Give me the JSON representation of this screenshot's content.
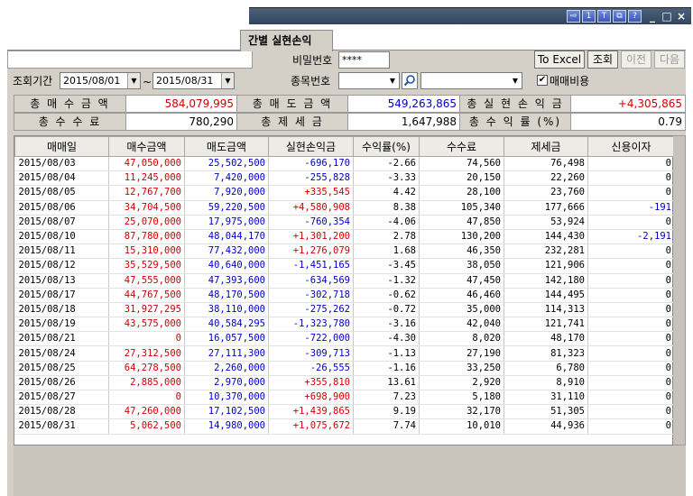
{
  "tab": {
    "title": "간별 실현손익"
  },
  "query": {
    "period_label": "조회기간",
    "start_date": "2015/08/01",
    "tilde": "~",
    "end_date": "2015/08/31",
    "password_label": "비밀번호",
    "password_value": "****",
    "stock_label": "종목번호",
    "excel_button": "To Excel",
    "search_button": "조회",
    "prev_button": "이전",
    "next_button": "다음",
    "fee_checkbox_label": "매매비용",
    "fee_checkbox_checked": true
  },
  "summary": {
    "total_buy_label": "총 매 수 금 액",
    "total_buy_value": "584,079,995",
    "total_sell_label": "총 매 도 금 액",
    "total_sell_value": "549,263,865",
    "total_realized_label": "총 실 현 손 익 금",
    "total_realized_value": "+4,305,865",
    "total_fee_label": "총 수 수 료",
    "total_fee_value": "780,290",
    "total_tax_label": "총 제 세 금",
    "total_tax_value": "1,647,988",
    "total_return_label": "총 수 익 률 (%)",
    "total_return_value": "0.79"
  },
  "table": {
    "columns": [
      "매매일",
      "매수금액",
      "매도금액",
      "실현손익금",
      "수익률(%)",
      "수수료",
      "제세금",
      "신용이자"
    ],
    "rows": [
      [
        "2015/08/03",
        "47,050,000",
        "25,502,500",
        "-696,170",
        "-2.66",
        "74,560",
        "76,498",
        "0"
      ],
      [
        "2015/08/04",
        "11,245,000",
        "7,420,000",
        "-255,828",
        "-3.33",
        "20,150",
        "22,260",
        "0"
      ],
      [
        "2015/08/05",
        "12,767,700",
        "7,920,000",
        "+335,545",
        "4.42",
        "28,100",
        "23,760",
        "0"
      ],
      [
        "2015/08/06",
        "34,704,500",
        "59,220,500",
        "+4,580,908",
        "8.38",
        "105,340",
        "177,666",
        "-191"
      ],
      [
        "2015/08/07",
        "25,070,000",
        "17,975,000",
        "-760,354",
        "-4.06",
        "47,850",
        "53,924",
        "0"
      ],
      [
        "2015/08/10",
        "87,780,000",
        "48,044,170",
        "+1,301,200",
        "2.78",
        "130,200",
        "144,430",
        "-2,191"
      ],
      [
        "2015/08/11",
        "15,310,000",
        "77,432,000",
        "+1,276,079",
        "1.68",
        "46,350",
        "232,281",
        "0"
      ],
      [
        "2015/08/12",
        "35,529,500",
        "40,640,000",
        "-1,451,165",
        "-3.45",
        "38,050",
        "121,906",
        "0"
      ],
      [
        "2015/08/13",
        "47,555,000",
        "47,393,600",
        "-634,569",
        "-1.32",
        "47,450",
        "142,180",
        "0"
      ],
      [
        "2015/08/17",
        "44,767,500",
        "48,170,500",
        "-302,718",
        "-0.62",
        "46,460",
        "144,495",
        "0"
      ],
      [
        "2015/08/18",
        "31,927,295",
        "38,110,000",
        "-275,262",
        "-0.72",
        "35,000",
        "114,313",
        "0"
      ],
      [
        "2015/08/19",
        "43,575,000",
        "40,584,295",
        "-1,323,780",
        "-3.16",
        "42,040",
        "121,741",
        "0"
      ],
      [
        "2015/08/21",
        "0",
        "16,057,500",
        "-722,000",
        "-4.30",
        "8,020",
        "48,170",
        "0"
      ],
      [
        "2015/08/24",
        "27,312,500",
        "27,111,300",
        "-309,713",
        "-1.13",
        "27,190",
        "81,323",
        "0"
      ],
      [
        "2015/08/25",
        "64,278,500",
        "2,260,000",
        "-26,555",
        "-1.16",
        "33,250",
        "6,780",
        "0"
      ],
      [
        "2015/08/26",
        "2,885,000",
        "2,970,000",
        "+355,810",
        "13.61",
        "2,920",
        "8,910",
        "0"
      ],
      [
        "2015/08/27",
        "0",
        "10,370,000",
        "+698,900",
        "7.23",
        "5,180",
        "31,110",
        "0"
      ],
      [
        "2015/08/28",
        "47,260,000",
        "17,102,500",
        "+1,439,865",
        "9.19",
        "32,170",
        "51,305",
        "0"
      ],
      [
        "2015/08/31",
        "5,062,500",
        "14,980,000",
        "+1,075,672",
        "7.74",
        "10,010",
        "44,936",
        "0"
      ]
    ]
  },
  "titlebar": {
    "buttons": [
      "arrow-right-icon",
      "1",
      "T",
      "copy-icon",
      "?"
    ],
    "minimize": "_",
    "maximize": "□",
    "close": "×"
  },
  "colors": {
    "buy": "#d00000",
    "sell": "#0000c8",
    "profit": "#d00000",
    "loss": "#0000c8"
  }
}
